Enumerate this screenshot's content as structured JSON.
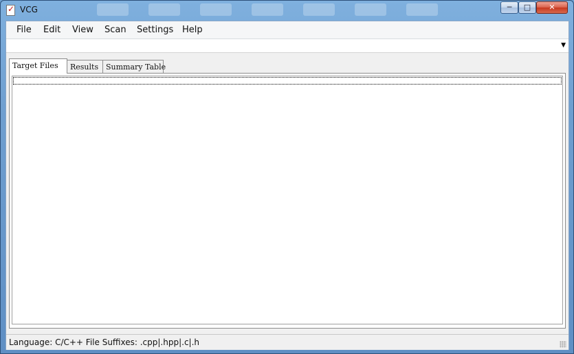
{
  "window": {
    "title": "VCG",
    "controls": {
      "minimize": "─",
      "maximize": "□",
      "close": "✕"
    }
  },
  "menu": {
    "items": [
      "File",
      "Edit",
      "View",
      "Scan",
      "Settings",
      "Help"
    ]
  },
  "toolbar": {
    "combo_value": "",
    "combo_arrow": "▼"
  },
  "tabs": [
    {
      "label": "Target Files",
      "active": true
    },
    {
      "label": "Results",
      "active": false
    },
    {
      "label": "Summary Table",
      "active": false
    }
  ],
  "status": {
    "text": "Language: C/C++   File Suffixes: .cpp|.hpp|.c|.h"
  },
  "icons": [
    "app-icon",
    "size-grip-icon"
  ],
  "colors": {
    "titlebar": "#6f9fd0",
    "close_button": "#c7381f",
    "client": "#f0f0f0"
  }
}
